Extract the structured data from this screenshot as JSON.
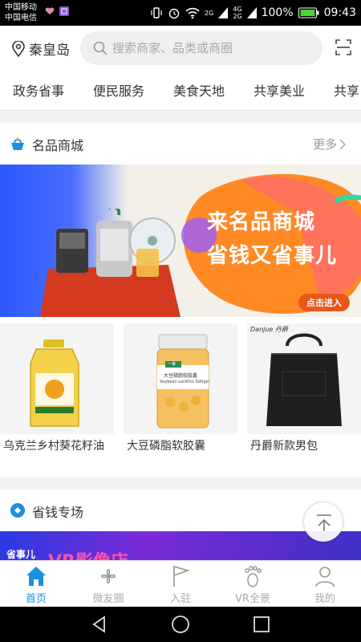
{
  "status_bar": {
    "carrier1": "中国移动",
    "carrier2": "中国电信",
    "network1": "2G",
    "network2": "4G",
    "network3": "2G",
    "battery": "100%",
    "time": "09:43"
  },
  "header": {
    "location": "秦皇岛",
    "search_placeholder": "搜索商家、品类或商圈"
  },
  "categories": [
    "政务省事",
    "便民服务",
    "美食天地",
    "共享美业",
    "共享"
  ],
  "section1": {
    "title": "名品商城",
    "more": "更多"
  },
  "banner": {
    "line1": "来名品商城",
    "line2": "省钱又省事儿",
    "cta": "点击进入"
  },
  "products": [
    {
      "name": "乌克兰乡村葵花籽油"
    },
    {
      "name": "大豆磷脂软胶囊",
      "label_brand": "一番",
      "label_cn": "大豆磷脂软胶囊",
      "label_en": "Soybean Lecithin Softgel"
    },
    {
      "name": "丹爵新款男包",
      "brand": "Danjue 丹爵"
    }
  ],
  "section2": {
    "title": "省钱专场"
  },
  "promo": {
    "logo": "省事儿",
    "text": "VR影像店"
  },
  "tabs": [
    {
      "label": "首页",
      "icon": "home-icon"
    },
    {
      "label": "微友圈",
      "icon": "pinwheel-icon"
    },
    {
      "label": "入驻",
      "icon": "flag-icon"
    },
    {
      "label": "VR全景",
      "icon": "footprint-icon"
    },
    {
      "label": "我的",
      "icon": "user-icon"
    }
  ],
  "colors": {
    "accent": "#1b8fe0",
    "banner_orange": "#ff7a1f",
    "cta": "#e8561a"
  }
}
